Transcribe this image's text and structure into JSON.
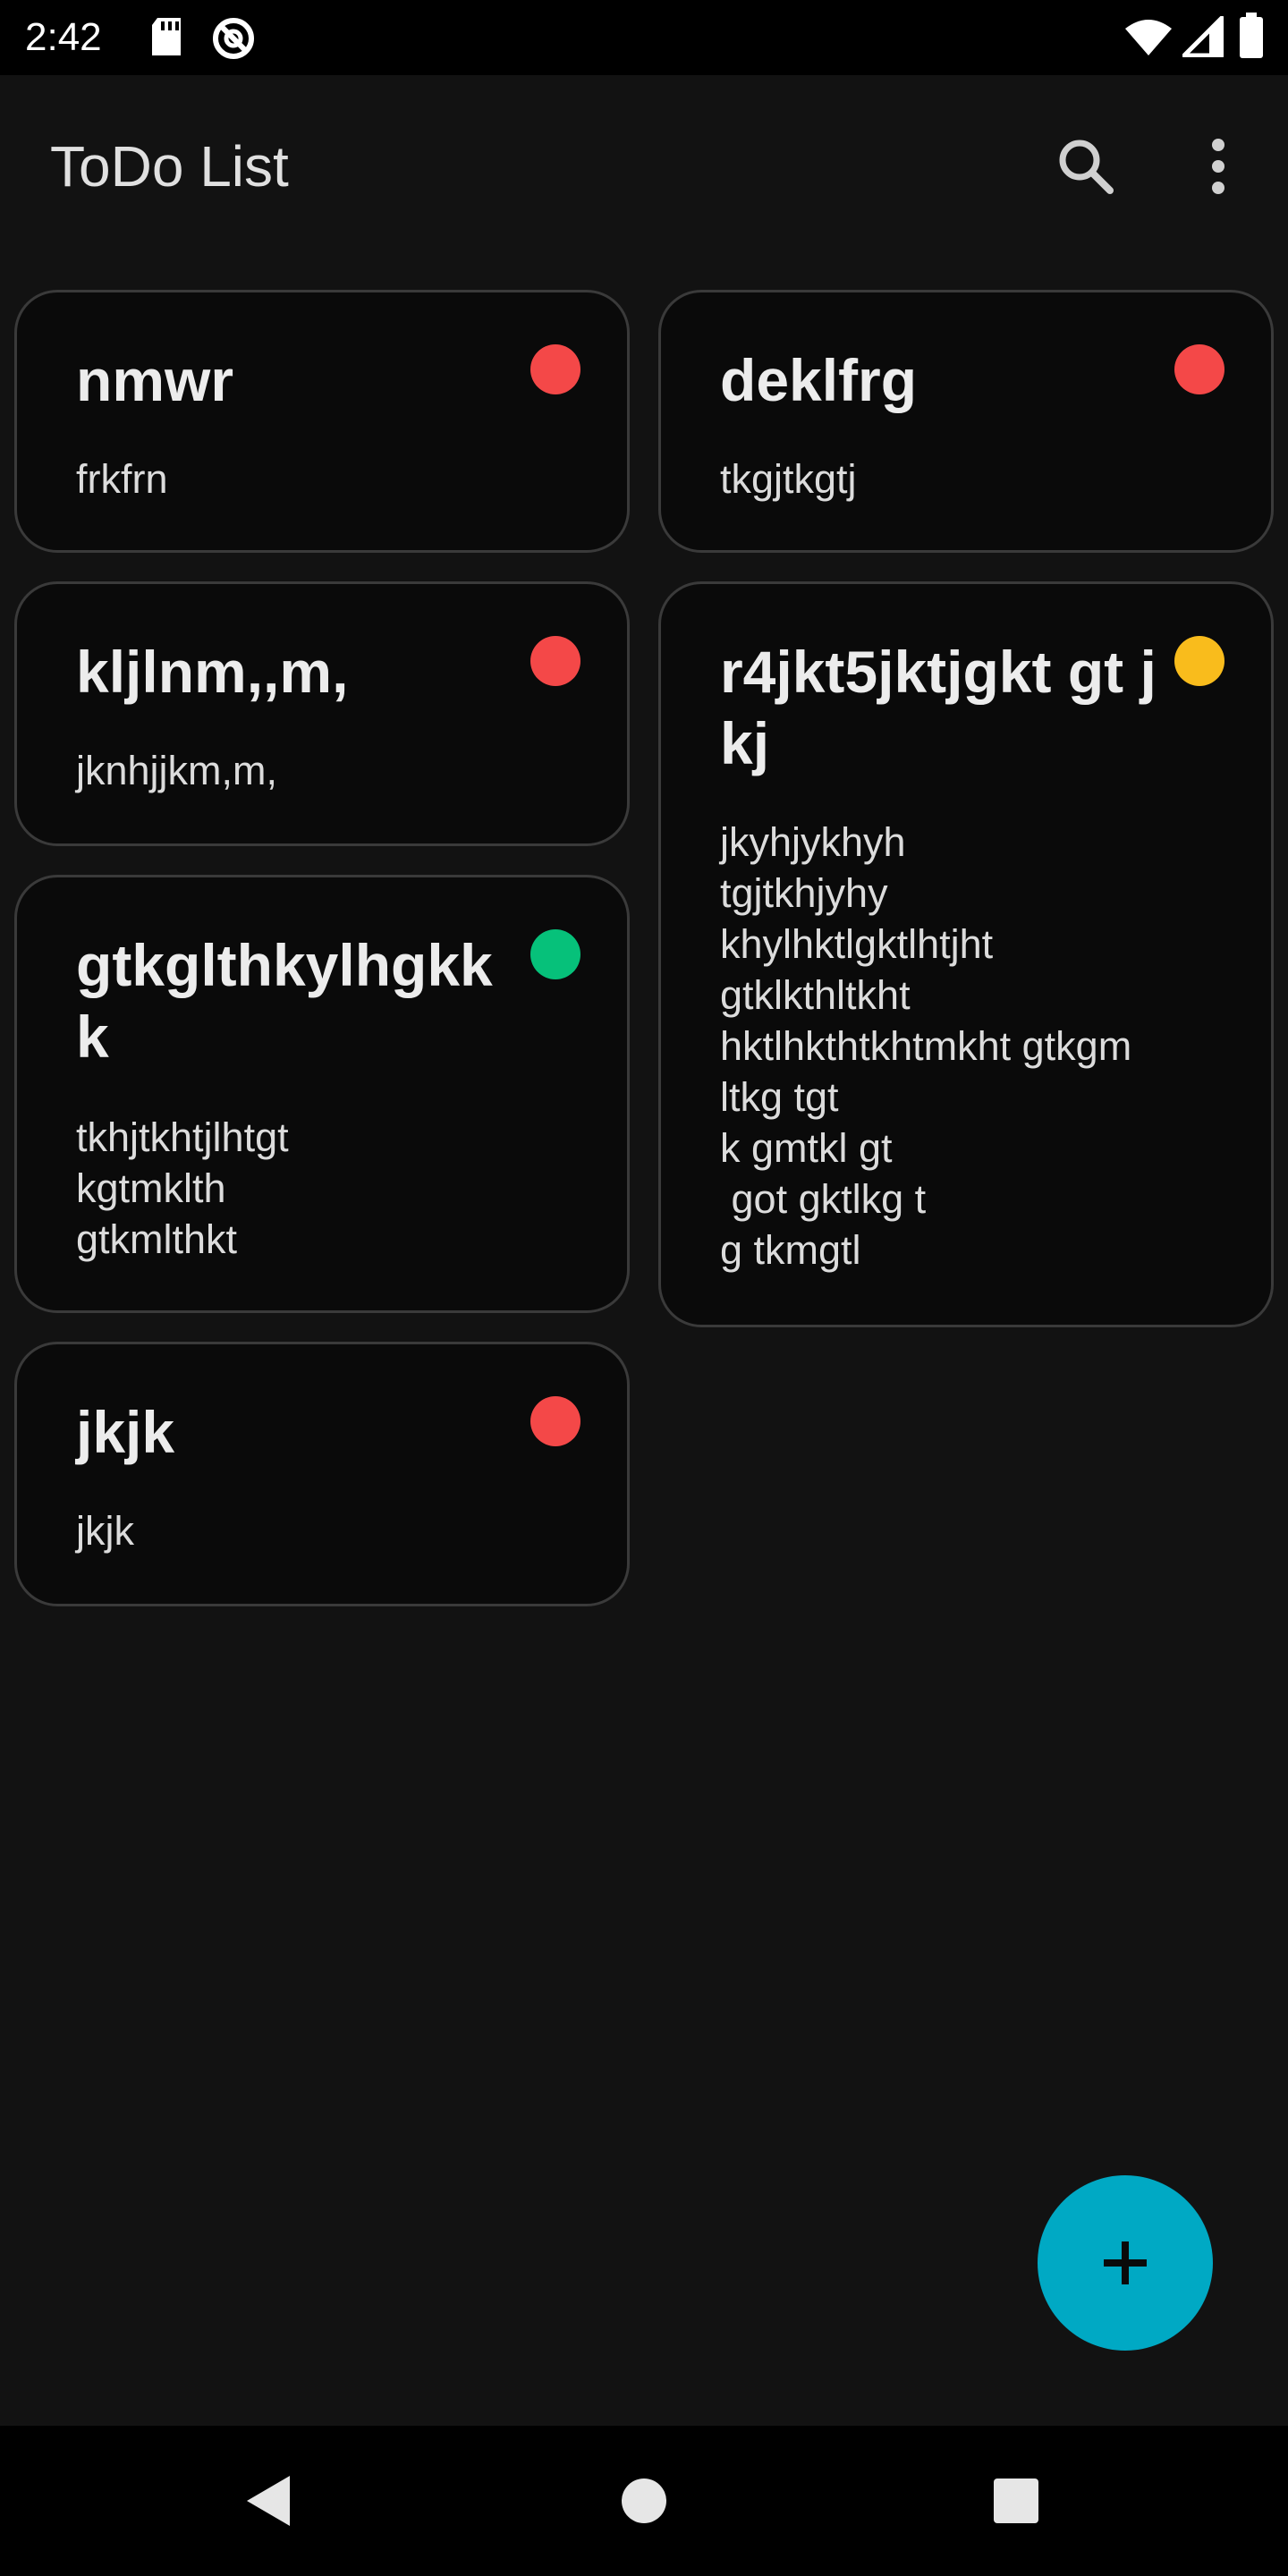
{
  "status_bar": {
    "time": "2:42",
    "left_icons": [
      "sd-card-icon",
      "do-not-disturb-icon"
    ],
    "right_icons": [
      "wifi-icon",
      "signal-icon",
      "battery-icon"
    ]
  },
  "app_bar": {
    "title": "ToDo List",
    "actions": [
      "search-icon",
      "more-vert-icon"
    ]
  },
  "notes": [
    {
      "title": "nmwr",
      "body": "frkfrn",
      "priority_color": "#f44848"
    },
    {
      "title": "deklfrg",
      "body": "tkgjtkgtj",
      "priority_color": "#f44848"
    },
    {
      "title": "kljlnm,,m,",
      "body": "jknhjjkm,m,",
      "priority_color": "#f44848"
    },
    {
      "title": "r4jkt5jktjgkt gt jkj",
      "body": "jkyhjykhyh\ntgjtkhjyhy\nkhylhktlgktlhtjht\ngtklkthltkht\nhktlhkthtkhtmkht gtkgm\nltkg tgt\nk gmtkl gt\n got gktlkg t\ng tkmgtl",
      "priority_color": "#f9bc1c"
    },
    {
      "title": "gtkglthkylhgkk\nk",
      "body": "tkhjtkhtjlhtgt\nkgtmklth\ngtkmlthkt",
      "priority_color": "#06c17a"
    },
    {
      "title": "jkjk",
      "body": "jkjk",
      "priority_color": "#f44848"
    }
  ],
  "fab": {
    "icon": "plus-icon",
    "color": "#00a9c4"
  },
  "nav_bar": {
    "buttons": [
      "back-icon",
      "home-icon",
      "recents-icon"
    ]
  }
}
